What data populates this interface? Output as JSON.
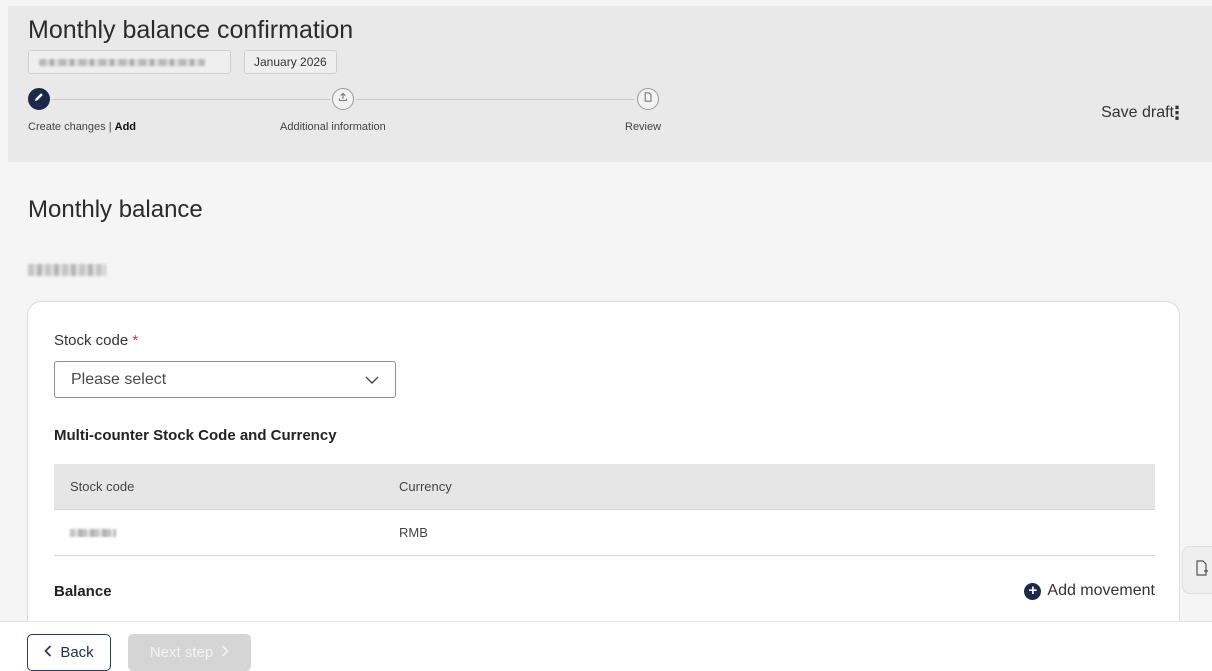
{
  "header": {
    "title": "Monthly balance confirmation",
    "period_chip": "January 2026",
    "save_draft_label": "Save draft",
    "more_menu_label": "⋮",
    "steps": [
      {
        "label_prefix": "Create changes | ",
        "label_bold": "Add",
        "icon": "pencil-icon",
        "state": "active"
      },
      {
        "label": "Additional information",
        "icon": "upload-icon",
        "state": "pending"
      },
      {
        "label": "Review",
        "icon": "document-icon",
        "state": "pending"
      }
    ]
  },
  "main": {
    "section_title": "Monthly balance",
    "stock_code_label": "Stock code",
    "required_marker": "*",
    "stock_code_placeholder": "Please select",
    "multi_counter_heading": "Multi-counter Stock Code and Currency",
    "table": {
      "columns": [
        "Stock code",
        "Currency"
      ],
      "rows": [
        {
          "stock_code": "",
          "currency": "RMB"
        }
      ]
    },
    "balance_label": "Balance",
    "add_movement_label": "Add movement"
  },
  "footer": {
    "back_label": "Back",
    "next_label": "Next step"
  },
  "colors": {
    "primary_navy": "#1b2a4a",
    "required_red": "#d43c3c",
    "header_bg": "#e9e9e9",
    "disabled_button": "#d5d5d5"
  }
}
